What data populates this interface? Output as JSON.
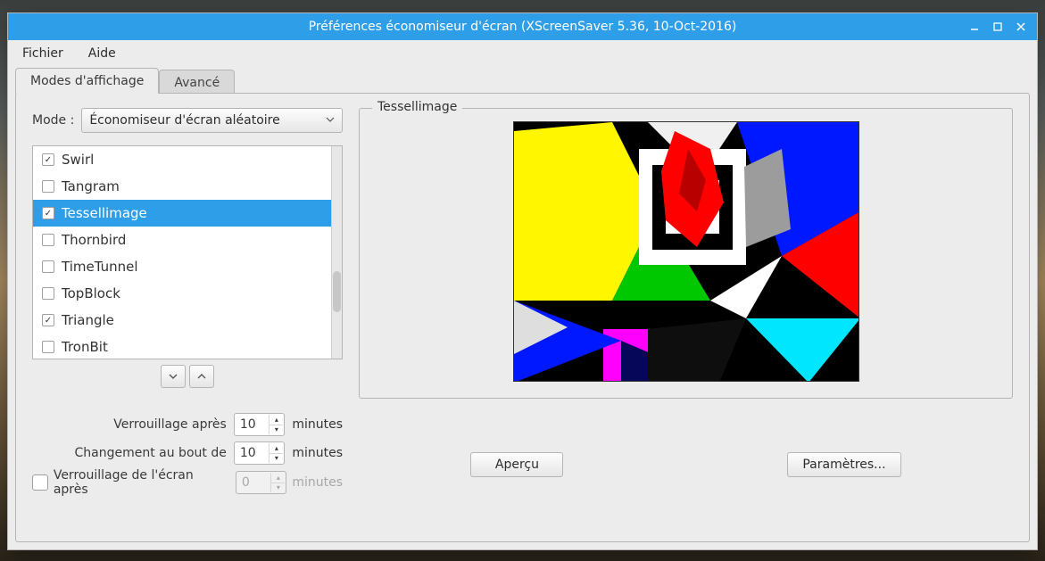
{
  "window": {
    "title": "Préférences économiseur d'écran  (XScreenSaver 5.36, 10-Oct-2016)"
  },
  "menubar": {
    "file": "Fichier",
    "help": "Aide"
  },
  "tabs": {
    "display": "Modes d'affichage",
    "advanced": "Avancé"
  },
  "mode": {
    "label": "Mode :",
    "selected": "Économiseur d'écran aléatoire"
  },
  "list": {
    "items": [
      {
        "label": "Swirl",
        "checked": true,
        "selected": false
      },
      {
        "label": "Tangram",
        "checked": false,
        "selected": false
      },
      {
        "label": "Tessellimage",
        "checked": true,
        "selected": true
      },
      {
        "label": "Thornbird",
        "checked": false,
        "selected": false
      },
      {
        "label": "TimeTunnel",
        "checked": false,
        "selected": false
      },
      {
        "label": "TopBlock",
        "checked": false,
        "selected": false
      },
      {
        "label": "Triangle",
        "checked": true,
        "selected": false
      },
      {
        "label": "TronBit",
        "checked": false,
        "selected": false
      }
    ]
  },
  "form": {
    "blank_label": "Verrouillage après",
    "blank_value": "10",
    "cycle_label": "Changement au bout de",
    "cycle_value": "10",
    "minutes": "minutes",
    "lock_label": "Verrouillage de l'écran après",
    "lock_value": "0",
    "lock_checked": false
  },
  "preview": {
    "legend": "Tessellimage",
    "apercu": "Aperçu",
    "params": "Paramètres..."
  },
  "colors": {
    "accent": "#2f9ee9"
  }
}
